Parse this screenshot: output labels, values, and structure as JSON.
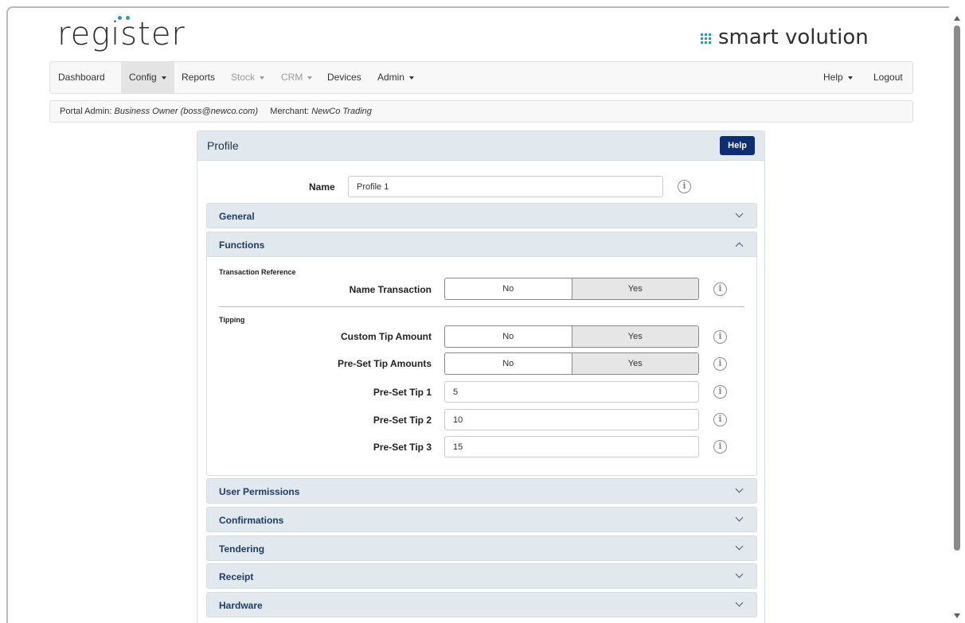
{
  "brand": {
    "left_logo": "register",
    "right_logo": "smart volution",
    "accent_color": "#2c9bb8"
  },
  "nav": {
    "items": [
      {
        "label": "Dashboard"
      },
      {
        "label": "Config"
      },
      {
        "label": "Reports"
      },
      {
        "label": "Stock"
      },
      {
        "label": "CRM"
      },
      {
        "label": "Devices"
      },
      {
        "label": "Admin"
      }
    ],
    "right": [
      {
        "label": "Help"
      },
      {
        "label": "Logout"
      }
    ]
  },
  "info": {
    "admin_label": "Portal Admin:",
    "admin_value": "Business Owner (boss@newco.com)",
    "merchant_label": "Merchant:",
    "merchant_value": "NewCo Trading"
  },
  "panel": {
    "title": "Profile",
    "help_label": "Help",
    "help_color": "#0d2e73",
    "name_label": "Name",
    "name_value": "Profile 1",
    "info_glyph": "i"
  },
  "sections": {
    "general": "General",
    "functions": "Functions",
    "user_permissions": "User Permissions",
    "confirmations": "Confirmations",
    "tendering": "Tendering",
    "receipt": "Receipt",
    "hardware": "Hardware"
  },
  "functions": {
    "transaction_reference": "Transaction Reference",
    "name_transaction": {
      "label": "Name Transaction",
      "no": "No",
      "yes": "Yes"
    },
    "tipping": "Tipping",
    "custom_tip": {
      "label": "Custom Tip Amount",
      "no": "No",
      "yes": "Yes"
    },
    "preset_tips": {
      "label": "Pre-Set Tip Amounts",
      "no": "No",
      "yes": "Yes"
    },
    "tip1": {
      "label": "Pre-Set Tip 1",
      "value": "5"
    },
    "tip2": {
      "label": "Pre-Set Tip 2",
      "value": "10"
    },
    "tip3": {
      "label": "Pre-Set Tip 3",
      "value": "15"
    }
  }
}
